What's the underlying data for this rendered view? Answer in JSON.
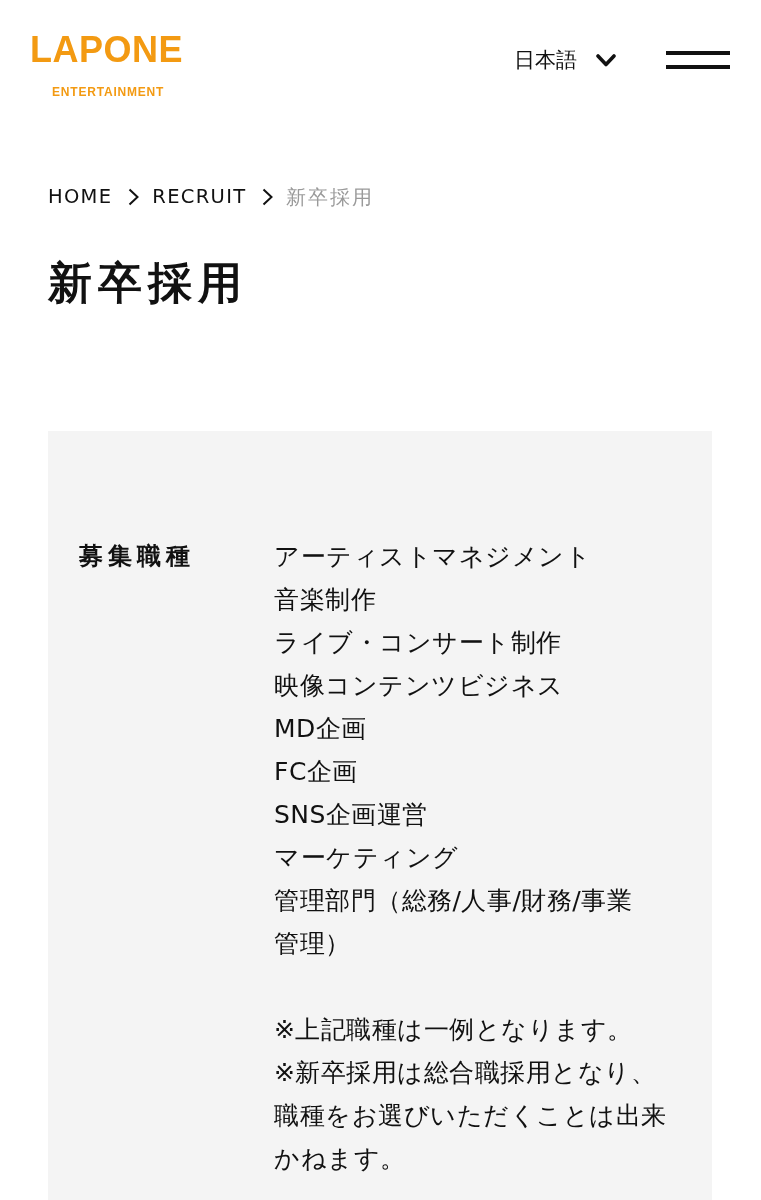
{
  "header": {
    "logo": {
      "name": "LAPONE",
      "tagline": "ENTERTAINMENT"
    },
    "language": {
      "label": "日本語"
    }
  },
  "breadcrumb": [
    {
      "label": "HOME",
      "current": false
    },
    {
      "label": "RECRUIT",
      "current": false
    },
    {
      "label": "新卒採用",
      "current": true
    }
  ],
  "page_title": "新卒採用",
  "details": [
    {
      "label": "募集職種",
      "items": [
        "アーティストマネジメント",
        "音楽制作",
        "ライブ・コンサート制作",
        "映像コンテンツビジネス",
        "MD企画",
        "FC企画",
        "SNS企画運営",
        "マーケティング",
        "管理部門（総務/人事/財務/事業管理）"
      ],
      "notes": [
        "※上記職種は一例となります。",
        "※新卒採用は総合職採用となり、職種をお選びいただくことは出来かねます。"
      ]
    }
  ]
}
